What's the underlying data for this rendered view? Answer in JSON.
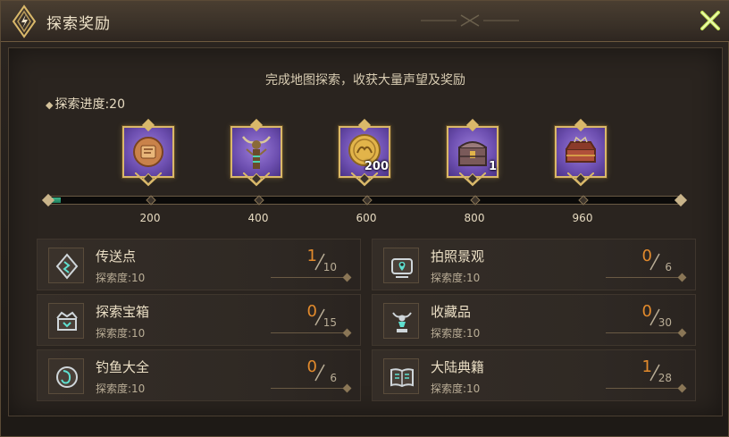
{
  "window": {
    "title": "探索奖励"
  },
  "header": {
    "subtitle": "完成地图探索，收获大量声望及奖励"
  },
  "progress": {
    "label": "探索进度:20",
    "current": 20,
    "max": 960
  },
  "rewards": [
    {
      "milestone": "200",
      "item": "parchment-scroll-coin",
      "quantity": ""
    },
    {
      "milestone": "400",
      "item": "antlered-totem-banner",
      "quantity": ""
    },
    {
      "milestone": "600",
      "item": "gold-reputation-coin",
      "quantity": "200"
    },
    {
      "milestone": "800",
      "item": "treasure-chest",
      "quantity": "1"
    },
    {
      "milestone": "960",
      "item": "ornate-treasure-box",
      "quantity": ""
    }
  ],
  "tasks": [
    {
      "name": "传送点",
      "sub": "探索度:10",
      "current": "1",
      "total": "10",
      "icon": "teleport-rune-icon"
    },
    {
      "name": "拍照景观",
      "sub": "探索度:10",
      "current": "0",
      "total": "6",
      "icon": "camera-pin-icon"
    },
    {
      "name": "探索宝箱",
      "sub": "探索度:10",
      "current": "0",
      "total": "15",
      "icon": "chest-icon"
    },
    {
      "name": "收藏品",
      "sub": "探索度:10",
      "current": "0",
      "total": "30",
      "icon": "collectible-statue-icon"
    },
    {
      "name": "钓鱼大全",
      "sub": "探索度:10",
      "current": "0",
      "total": "6",
      "icon": "fishing-hook-icon"
    },
    {
      "name": "大陆典籍",
      "sub": "探索度:10",
      "current": "1",
      "total": "28",
      "icon": "book-icon"
    }
  ],
  "colors": {
    "accent_gold": "#d9b86a",
    "progress_green": "#3fb58c",
    "count_orange": "#e28a2c",
    "close_green": "#c8e65a"
  }
}
